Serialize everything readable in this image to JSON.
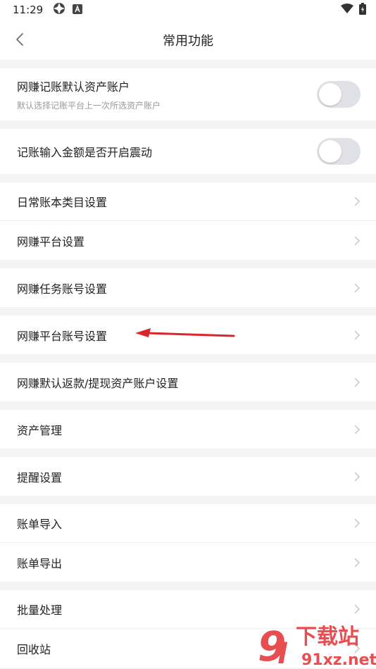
{
  "status": {
    "time": "11:29"
  },
  "nav": {
    "title": "常用功能"
  },
  "groups": [
    [
      {
        "label": "网赚记账默认资产账户",
        "sub": "默认选择记账平台上一次所选资产账户",
        "toggle": false
      }
    ],
    [
      {
        "label": "记账输入金额是否开启震动",
        "toggle": false
      }
    ],
    [
      {
        "label": "日常账本类目设置"
      },
      {
        "label": "网赚平台设置"
      }
    ],
    [
      {
        "label": "网赚任务账号设置"
      }
    ],
    [
      {
        "label": "网赚平台账号设置"
      }
    ],
    [
      {
        "label": "网赚默认返款/提现资产账户设置"
      }
    ],
    [
      {
        "label": "资产管理"
      }
    ],
    [
      {
        "label": "提醒设置"
      }
    ],
    [
      {
        "label": "账单导入"
      },
      {
        "label": "账单导出"
      }
    ],
    [
      {
        "label": "批量处理"
      },
      {
        "label": "回收站"
      }
    ]
  ],
  "watermark": {
    "brand": "下载站",
    "domain": "91xz.net"
  },
  "colors": {
    "annotation_arrow": "#d9262c",
    "toggle_off": "#dfe1e6",
    "watermark": "#e63a3f"
  }
}
